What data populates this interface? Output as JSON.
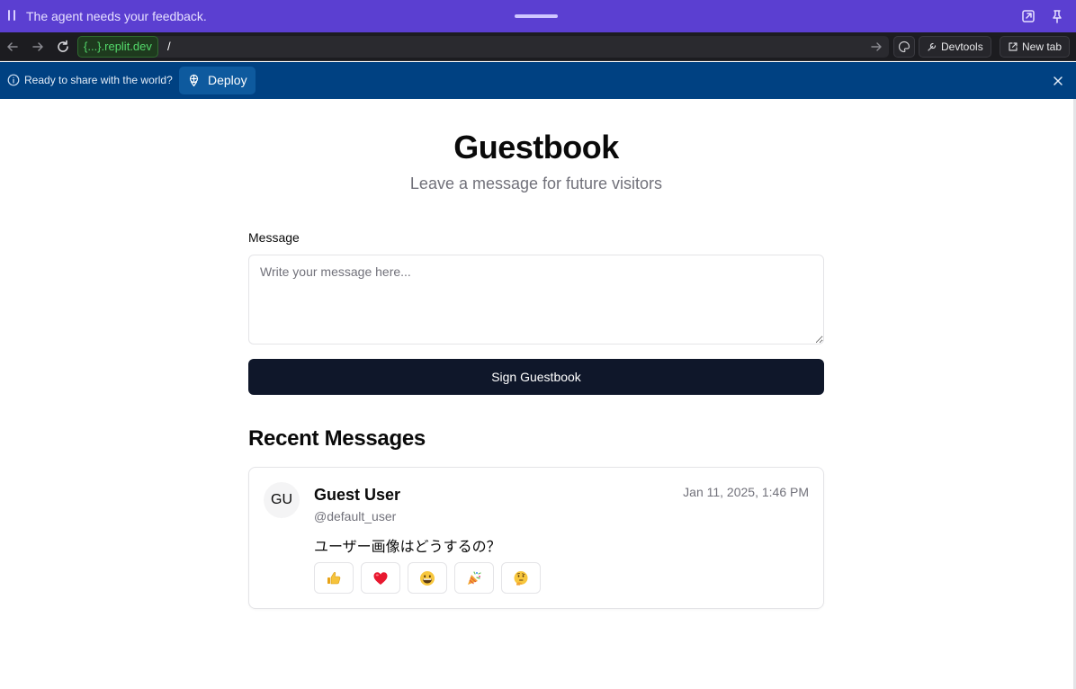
{
  "agent_bar": {
    "message": "The agent needs your feedback.",
    "icons": [
      "pause-icon",
      "drag-handle",
      "open-external-icon",
      "pin-icon"
    ]
  },
  "url_bar": {
    "domain": "{...}.replit.dev",
    "path": "/",
    "devtools_label": "Devtools",
    "new_tab_label": "New tab"
  },
  "deploy_bar": {
    "prompt": "Ready to share with the world?",
    "deploy_label": "Deploy"
  },
  "page": {
    "title": "Guestbook",
    "subtitle": "Leave a message for future visitors",
    "form": {
      "label": "Message",
      "placeholder": "Write your message here...",
      "value": "",
      "submit_label": "Sign Guestbook"
    },
    "recent_title": "Recent Messages",
    "messages": [
      {
        "initials": "GU",
        "author": "Guest User",
        "handle": "@default_user",
        "timestamp": "Jan 11, 2025, 1:46 PM",
        "body": "ユーザー画像はどうするの？",
        "reactions": [
          "thumbs-up",
          "red-heart",
          "grinning-face",
          "party-popper",
          "thinking-face"
        ]
      }
    ]
  },
  "colors": {
    "agent_bar": "#5b3fd1",
    "url_bar": "#1c1c20",
    "domain_text": "#53d86a",
    "deploy_bar": "#004182",
    "deploy_button": "#0e5a9e",
    "primary_button": "#0f172a",
    "muted_text": "#71717a"
  }
}
